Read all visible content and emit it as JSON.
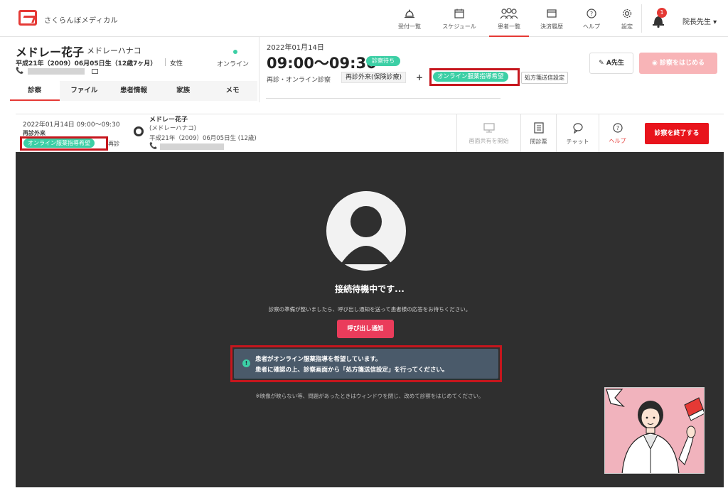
{
  "app": {
    "brand": "さくらんぼメディカル"
  },
  "nav": [
    {
      "label": "受付一覧",
      "icon": "reception-bell-icon"
    },
    {
      "label": "スケジュール",
      "icon": "calendar-icon"
    },
    {
      "label": "患者一覧",
      "icon": "patients-icon"
    },
    {
      "label": "決済履歴",
      "icon": "card-icon"
    },
    {
      "label": "ヘルプ",
      "icon": "help-icon"
    },
    {
      "label": "設定",
      "icon": "gear-icon"
    }
  ],
  "notifications": {
    "count": "1"
  },
  "user": {
    "label": "院長先生 ▾"
  },
  "patient": {
    "name": "メドレー花子",
    "kana": "メドレーハナコ",
    "birth": "平成21年（2009）06月05日生（12歳7ヶ月）",
    "sex": "女性",
    "status": "オンライン",
    "phone_icon": "📞"
  },
  "tabs": [
    "診察",
    "ファイル",
    "患者情報",
    "家族",
    "メモ"
  ],
  "appointment": {
    "date": "2022年01月14日",
    "time": "09:00〜09:30",
    "status": "診察待ち",
    "type": "再診・オンライン診察",
    "category": "再診外来(保険診療)",
    "plus": "+",
    "medication_guidance": "オンライン服薬指導希望",
    "prescription_setting": "処方箋送信設定"
  },
  "actions": {
    "doctor": "A先生",
    "start": "診察をはじめる"
  },
  "video_bar": {
    "date": "2022年01月14日 09:00〜09:30",
    "type": "再診外来",
    "tag": "オンライン服薬指導希望",
    "repeat": "再診",
    "name": "メドレー花子",
    "kana": "(メドレーハナコ)",
    "birth": "平成21年（2009）06月05日生 (12歳)",
    "tools": {
      "screen_share": "画面共有を開始",
      "questionnaire": "問診票",
      "chat": "チャット",
      "help": "ヘルプ"
    },
    "end": "診察を終了する"
  },
  "video": {
    "title": "接続待機中です...",
    "description": "診察の準備が整いましたら、呼び出し通知を送って患者様の応答をお待ちください。",
    "call_button": "呼び出し通知",
    "notice_line1": "患者がオンライン服薬指導を希望しています。",
    "notice_line2": "患者に確認の上、診察画面から「処方箋送信設定」を行ってください。",
    "footnote": "※映像が映らない等、問題があったときはウィンドウを閉じ、改めて診察をはじめてください。"
  },
  "colors": {
    "brand_red": "#e53935",
    "accent_green": "#3ccfa5",
    "highlight_red": "#c6161d",
    "video_bg": "#2f2f2f"
  }
}
